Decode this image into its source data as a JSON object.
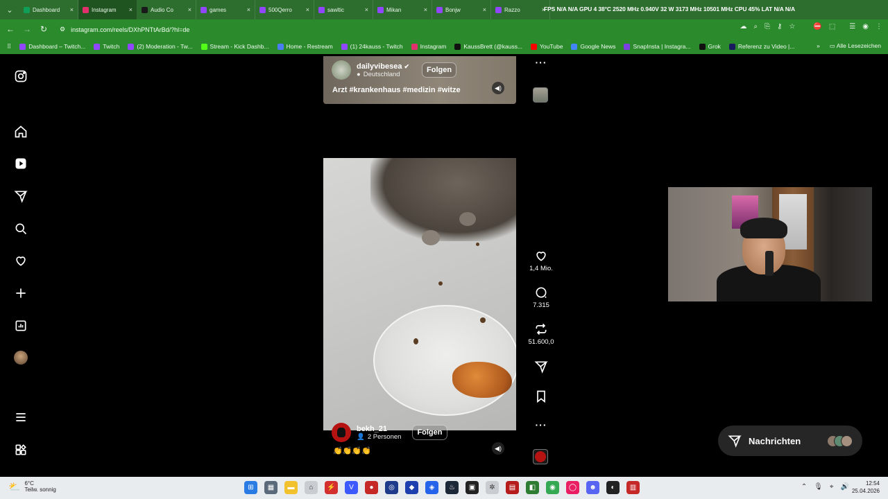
{
  "browser": {
    "tabs": [
      {
        "label": "Dashboard",
        "fav_color": "#0f9d58",
        "active": false
      },
      {
        "label": "Instagram",
        "fav_color": "#e1306c",
        "active": true
      },
      {
        "label": "Audio Co",
        "fav_color": "#1a1a1a",
        "active": false
      },
      {
        "label": "games",
        "fav_color": "#9146ff",
        "active": false
      },
      {
        "label": "500Qerro",
        "fav_color": "#9146ff",
        "active": false
      },
      {
        "label": "sawltic",
        "fav_color": "#9146ff",
        "active": false
      },
      {
        "label": "Mikan",
        "fav_color": "#9146ff",
        "active": false
      },
      {
        "label": "Bonjw",
        "fav_color": "#9146ff",
        "active": false
      },
      {
        "label": "Razzo",
        "fav_color": "#9146ff",
        "active": false
      }
    ],
    "perf_overlay": "FPS N/A N/A  GPU 4 38°C 2520 MHz 0.940V 32 W 3173 MHz 10501 MHz  CPU 45%  LAT N/A N/A",
    "url": "instagram.com/reels/DXhPNTtArBd/?hl=de",
    "bookmarks": [
      {
        "label": "Dashboard – Twitch...",
        "color": "#9146ff"
      },
      {
        "label": "Twitch",
        "color": "#9146ff"
      },
      {
        "label": "(2) Moderation - Tw...",
        "color": "#9146ff"
      },
      {
        "label": "Stream - Kick Dashb...",
        "color": "#53fc18"
      },
      {
        "label": "Home - Restream",
        "color": "#4c7cf4"
      },
      {
        "label": "(1) 24kauss - Twitch",
        "color": "#9146ff"
      },
      {
        "label": "Instagram",
        "color": "#e1306c"
      },
      {
        "label": "KaussBrett (@kauss...",
        "color": "#111111"
      },
      {
        "label": "YouTube",
        "color": "#ff0000"
      },
      {
        "label": "Google News",
        "color": "#4285f4"
      },
      {
        "label": "SnapInsta | Instagra...",
        "color": "#7b3fe4"
      },
      {
        "label": "Grok",
        "color": "#111111"
      },
      {
        "label": "Referenz zu Video |...",
        "color": "#1a1a5e"
      }
    ],
    "bookmarks_more": "»",
    "all_bookmarks": "Alle Lesezeichen"
  },
  "reel_top": {
    "username": "dailyvibesea",
    "location": "Deutschland",
    "follow": "Folgen",
    "caption": "Arzt #krankenhaus #medizin #witze"
  },
  "reel_main": {
    "username": "bekh_21",
    "people": "2 Personen",
    "follow": "Folgen",
    "caption": "👏👏👏👏"
  },
  "actions": {
    "likes": "1,4 Mio.",
    "comments": "7.315",
    "reposts": "51.600,0"
  },
  "messages": {
    "label": "Nachrichten"
  },
  "taskbar": {
    "temp": "6°C",
    "weather": "Teilw. sonnig",
    "time": "12:54",
    "date": "25.04.2026"
  }
}
